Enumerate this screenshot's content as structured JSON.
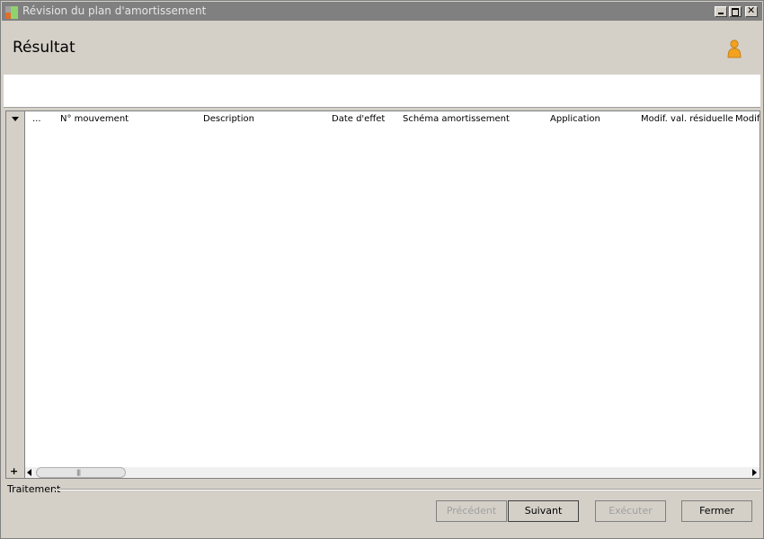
{
  "window": {
    "title": "Révision du plan d'amortissement"
  },
  "header": {
    "title": "Résultat",
    "user_icon": "user-icon"
  },
  "grid": {
    "row_menu_glyph": "▼",
    "columns": [
      "...",
      "N° mouvement",
      "Description",
      "Date d'effet",
      "Schéma amortissement",
      "Application",
      "Modif. val. résiduelle",
      "Modif"
    ],
    "add_glyph": "+",
    "scroll_grip": "|||"
  },
  "traitement": {
    "label": "Traitement"
  },
  "buttons": {
    "previous": "Précédent",
    "next": "Suivant",
    "execute": "Exécuter",
    "close": "Fermer"
  },
  "colors": {
    "titlebar": "#808080",
    "background": "#d4d0c8",
    "user_icon": "#f2a21f"
  }
}
